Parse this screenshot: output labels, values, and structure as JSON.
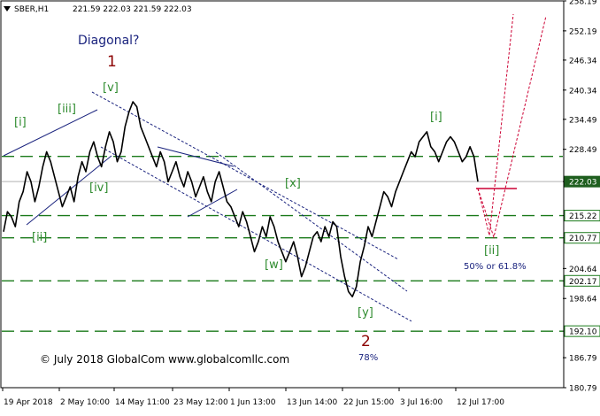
{
  "header": {
    "symbol": "SBER,H1",
    "ohlc": "221.59 222.03 221.59 222.03"
  },
  "colors": {
    "background": "#ffffff",
    "axis": "#000000",
    "price_line": "#000000",
    "guide_green": "#1a7a1a",
    "wave_green": "#2e8b2e",
    "wave_red": "#8b0000",
    "wave_navy": "#1a237e",
    "channel_navy": "#1a237e",
    "target_red": "#cc0033",
    "current_price_bg": "#1f5f1f"
  },
  "annotations": {
    "diagonal": "Diagonal?",
    "wave_1": "1",
    "wave_2": "2",
    "wave_2_pct": "78%",
    "v": "[v]",
    "i_left": "[i]",
    "iii": "[iii]",
    "iv": "[iv]",
    "ii_left": "[ii]",
    "x": "[x]",
    "w": "[w]",
    "y": "[y]",
    "i_right": "[i]",
    "ii_right": "[ii]",
    "retracement": "50% or 61.8%",
    "copyright": "© July 2018 GlobalCom www.globalcomllc.com"
  },
  "chart_data": {
    "type": "line",
    "title": "",
    "ylim": [
      180.79,
      258.19
    ],
    "price_ticks": [
      "258.19",
      "252.19",
      "246.34",
      "240.34",
      "234.49",
      "228.49",
      "222.03",
      "215.22",
      "210.77",
      "204.64",
      "202.17",
      "198.64",
      "192.10",
      "186.79",
      "180.79"
    ],
    "level_labels": [
      "227.07",
      "222.03",
      "215.22",
      "210.77",
      "202.17",
      "192.10"
    ],
    "current_price": "222.03",
    "x_labels": [
      "19 Apr 2018",
      "2 May 10:00",
      "14 May 11:00",
      "23 May 12:00",
      "1 Jun 13:00",
      "13 Jun 14:00",
      "22 Jun 15:00",
      "3 Jul 16:00",
      "12 Jul 17:00"
    ],
    "support_resistance": [
      227.07,
      215.22,
      210.77,
      202.17,
      192.1
    ],
    "series": [
      {
        "values": [
          212,
          216,
          215,
          213,
          218,
          220,
          224,
          222,
          218,
          221,
          225,
          228,
          226,
          223,
          220,
          217,
          219,
          221,
          218,
          223,
          226,
          224,
          228,
          230,
          227,
          225,
          229,
          232,
          230,
          226,
          228,
          233,
          236,
          238,
          237,
          233,
          231,
          229,
          227,
          225,
          228,
          226,
          222,
          224,
          226,
          223,
          221,
          224,
          222,
          219,
          221,
          223,
          220,
          218,
          222,
          224,
          221,
          218,
          217,
          215,
          213,
          216,
          214,
          211,
          208,
          210,
          213,
          211,
          215,
          213,
          210,
          208,
          206,
          208,
          210,
          207,
          203,
          205,
          208,
          211,
          212,
          210,
          213,
          211,
          214,
          213,
          207,
          203,
          200,
          199,
          201,
          206,
          209,
          213,
          211,
          214,
          217,
          220,
          219,
          217,
          220,
          222,
          224,
          226,
          228,
          227,
          230,
          231,
          232,
          229,
          228,
          226,
          228,
          230,
          231,
          230,
          228,
          226,
          227,
          229,
          227,
          222.03
        ]
      }
    ]
  }
}
